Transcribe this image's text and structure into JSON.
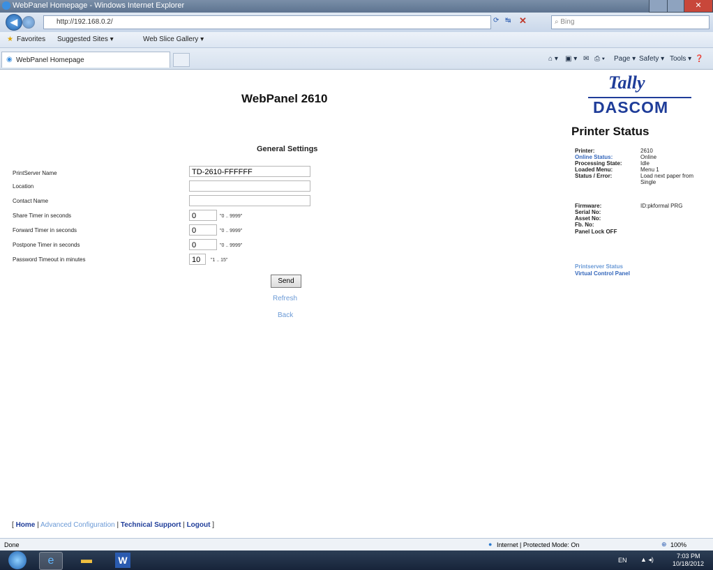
{
  "window": {
    "title": "WebPanel Homepage - Windows Internet Explorer"
  },
  "browser": {
    "url": "http://192.168.0.2/",
    "search_placeholder": "Bing",
    "favorites_label": "Favorites",
    "suggested_sites": "Suggested Sites ▾",
    "web_slice": "Web Slice Gallery ▾",
    "tab_title": "WebPanel Homepage",
    "cmd_page": "Page ▾",
    "cmd_safety": "Safety ▾",
    "cmd_tools": "Tools ▾"
  },
  "page": {
    "title": "WebPanel 2610",
    "logo_top": "Tally",
    "logo_bottom": "DASCOM"
  },
  "status_panel": {
    "heading": "Printer Status",
    "rows": [
      {
        "label": "Printer:",
        "value": "2610"
      },
      {
        "label": "Online Status:",
        "value": "Online"
      },
      {
        "label": "Processing State:",
        "value": "Idle"
      },
      {
        "label": "Loaded Menu:",
        "value": "Menu 1"
      },
      {
        "label": "Status / Error:",
        "value": "Load next paper from Single"
      }
    ],
    "firmware_label": "Firmware:",
    "firmware_value": "ID:pkformal PRG",
    "serial_label": "Serial No:",
    "asset_label": "Asset No:",
    "fb_label": "Fb. No:",
    "panel_lock": "Panel Lock OFF",
    "link_printserver": "Printserver Status",
    "link_virtual": "Virtual Control Panel"
  },
  "form": {
    "heading": "General Settings",
    "fields": [
      {
        "label": "PrintServer Name",
        "value": "TD-2610-FFFFFF",
        "hint": ""
      },
      {
        "label": "Location",
        "value": "",
        "hint": ""
      },
      {
        "label": "Contact Name",
        "value": "",
        "hint": ""
      },
      {
        "label": "Share Timer in seconds",
        "value": "0",
        "hint": "\"0 .. 9999\""
      },
      {
        "label": "Forward Timer in seconds",
        "value": "0",
        "hint": "\"0 .. 9999\""
      },
      {
        "label": "Postpone Timer in seconds",
        "value": "0",
        "hint": "\"0 .. 9999\""
      },
      {
        "label": "Password Timeout in minutes",
        "value": "10",
        "hint": "\"1 .. 15\""
      }
    ],
    "send_label": "Send",
    "refresh_label": "Refresh",
    "back_label": "Back"
  },
  "footer": {
    "open": "[",
    "home": "Home",
    "advanced": "Advanced Configuration",
    "tech": "Technical Support",
    "logout": "Logout",
    "sep": "|",
    "close": "]"
  },
  "statusbar": {
    "left": "Done",
    "zone": "Internet | Protected Mode: On",
    "zoom": "100%"
  },
  "taskbar": {
    "lang": "EN",
    "time": "7:03 PM",
    "date": "10/18/2012"
  }
}
